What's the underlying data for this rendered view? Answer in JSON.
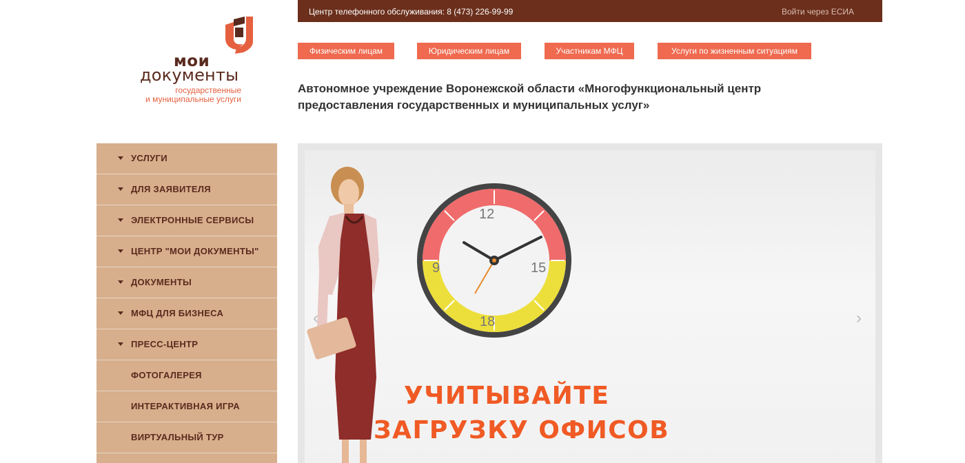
{
  "logo": {
    "line1": "мои",
    "line2": "документы",
    "sub1": "государственные",
    "sub2": "и муниципальные услуги"
  },
  "topbar": {
    "phone": "Центр телефонного обслуживания: 8 (473) 226-99-99",
    "esia": "Войти через ЕСИА"
  },
  "categories": [
    "Физическим лицам",
    "Юридическим лицам",
    "Участникам МФЦ",
    "Услуги по жизненным ситуациям"
  ],
  "org_title": "Автономное учреждение Воронежской области «Многофункциональный центр предоставления государственных и муниципальных услуг»",
  "menu": [
    {
      "label": "УСЛУГИ",
      "arrow": true
    },
    {
      "label": "ДЛЯ ЗАЯВИТЕЛЯ",
      "arrow": true
    },
    {
      "label": "ЭЛЕКТРОННЫЕ СЕРВИСЫ",
      "arrow": true
    },
    {
      "label": "ЦЕНТР \"МОИ ДОКУМЕНТЫ\"",
      "arrow": true
    },
    {
      "label": "ДОКУМЕНТЫ",
      "arrow": true
    },
    {
      "label": "МФЦ ДЛЯ БИЗНЕСА",
      "arrow": true
    },
    {
      "label": "ПРЕСС-ЦЕНТР",
      "arrow": true
    },
    {
      "label": "ФОТОГАЛЕРЕЯ",
      "arrow": false
    },
    {
      "label": "ИНТЕРАКТИВНАЯ ИГРА",
      "arrow": false
    },
    {
      "label": "ВИРТУАЛЬНЫЙ ТУР",
      "arrow": false
    }
  ],
  "slider": {
    "clock_numbers": [
      "12",
      "15",
      "18",
      "9"
    ],
    "line1": "УЧИТЫВАЙТЕ",
    "line2": "ЗАГРУЗКУ ОФИСОВ",
    "prev": "‹",
    "next": "›"
  },
  "colors": {
    "topbar": "#6b2f1c",
    "accent": "#ef6a4f",
    "sidebar": "#d7af8c",
    "menu_text": "#5a2a1e"
  }
}
